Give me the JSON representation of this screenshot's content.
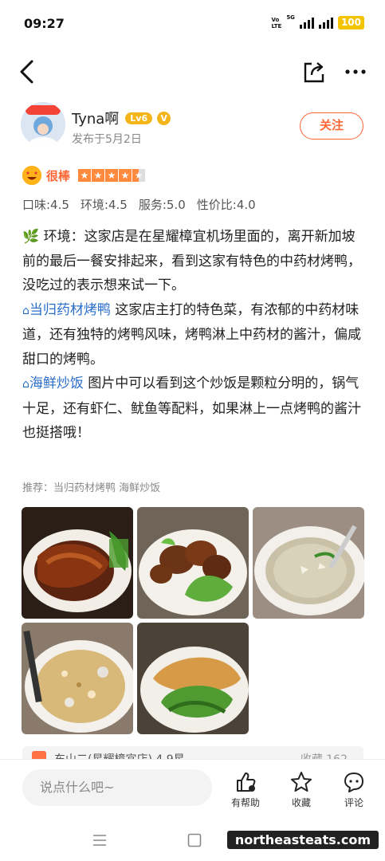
{
  "status": {
    "time": "09:27",
    "volte_top": "Vo",
    "volte_bottom": "LTE",
    "network": "5G",
    "battery": "100"
  },
  "author": {
    "name": "Tyna啊",
    "level": "Lv6",
    "verified": "V",
    "date": "发布于5月2日",
    "follow_label": "关注",
    "avatar_banner": "关注"
  },
  "rating": {
    "label": "很棒",
    "score": 4.5
  },
  "sub_scores": [
    "口味:4.5",
    "环境:4.5",
    "服务:5.0",
    "性价比:4.0"
  ],
  "review": {
    "env_prefix": "🌿",
    "env_text": "环境：这家店是在星耀樟宜机场里面的，离开新加坡前的最后一餐安排起来，看到这家有特色的中药材烤鸭，没吃过的表示想来试一下。",
    "dish1_name": "当归药材烤鸭",
    "dish1_text": " 这家店主打的特色菜，有浓郁的中药材味道，还有独特的烤鸭风味，烤鸭淋上中药材的酱汁，偏咸甜口的烤鸭。",
    "dish2_name": "海鲜炒饭",
    "dish2_text": " 图片中可以看到这个炒饭是颗粒分明的，锅气十足，还有虾仁、鱿鱼等配料，如果淋上一点烤鸭的酱汁也挺搭哦！",
    "bell": "⌂"
  },
  "recommend": "推荐：当归药材烤鸭 海鲜炒饭",
  "photos": [
    "roast-duck",
    "fried-chicken",
    "soup",
    "seafood-fried-rice",
    "crispy-vegetables"
  ],
  "shop": {
    "name": "东山二(星耀樟宜店)  4.9星",
    "fav": "收藏 162"
  },
  "bottom": {
    "comment_placeholder": "说点什么吧~",
    "helpful": "有帮助",
    "collect": "收藏",
    "comment": "评论"
  },
  "watermark": "northeasteats.com",
  "colors": {
    "accent": "#ff6633",
    "link": "#2a6fcc",
    "badge": "#f3b51a"
  }
}
